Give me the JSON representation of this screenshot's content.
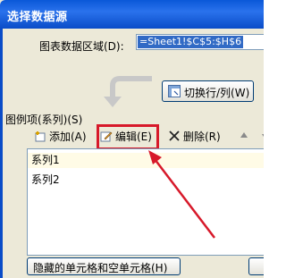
{
  "dialog": {
    "title": "选择数据源",
    "range_label": "图表数据区域(D):",
    "range_value": "=Sheet1!$C$5:$H$6",
    "switch_label": "切换行/列(W)",
    "legend_label": "图例项(系列)(S)",
    "toolbar": {
      "add_label": "添加(A)",
      "edit_label": "编辑(E)",
      "delete_label": "删除(R)"
    },
    "series": [
      {
        "label": "系列1"
      },
      {
        "label": "系列2"
      }
    ],
    "hidden_cells_label": "隐藏的单元格和空单元格(H)"
  },
  "colors": {
    "title_bar": "#0a58d8",
    "dialog_bg": "#ece9d8",
    "highlight": "#d7192a",
    "selection": "#316ac5"
  }
}
